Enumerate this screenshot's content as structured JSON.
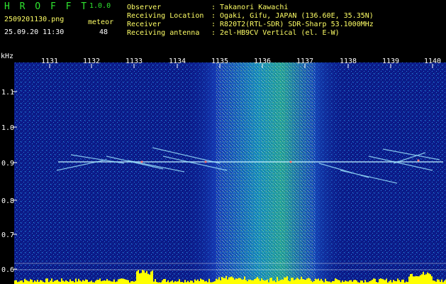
{
  "header": {
    "app_name": "H R O F F T",
    "version": "1.0.0",
    "filename": "2509201130.png",
    "datetime": "25.09.20 11:30",
    "meteor_label": "meteor",
    "meteor_count": "48"
  },
  "info": {
    "observer_label": "Observer",
    "observer_value": ": Takanori Kawachi",
    "location_label": "Receiving Location",
    "location_value": ": Ogaki, Gifu, JAPAN (136.60E, 35.35N)",
    "receiver_label": "Receiver",
    "receiver_value": ": R820T2(RTL-SDR) SDR-Sharp 53.1000MHz",
    "antenna_label": "Receiving antenna",
    "antenna_value": ": 2el-HB9CV Vertical (el. E-W)"
  },
  "axes": {
    "y_unit": "kHz",
    "y_ticks": [
      "1.1",
      "1.0",
      "0.9",
      "0.8",
      "0.7",
      "0.6"
    ],
    "x_ticks": [
      "1131",
      "1132",
      "1133",
      "1134",
      "1135",
      "1136",
      "1137",
      "1138",
      "1139",
      "1140"
    ]
  },
  "colors": {
    "text_green": "#2fe52f",
    "text_yellow": "#ffff66",
    "text_white": "#ffffff",
    "background": "#000000",
    "noise_floor": "#0a1a8a",
    "noise_high": "#00ffff",
    "signal_line": "#ffffff",
    "signal_yellow": "#ffff00"
  },
  "signal": {
    "carrier_khz": 0.9,
    "noise_band_start_min": 1135,
    "noise_band_end_min": 1137.5
  }
}
